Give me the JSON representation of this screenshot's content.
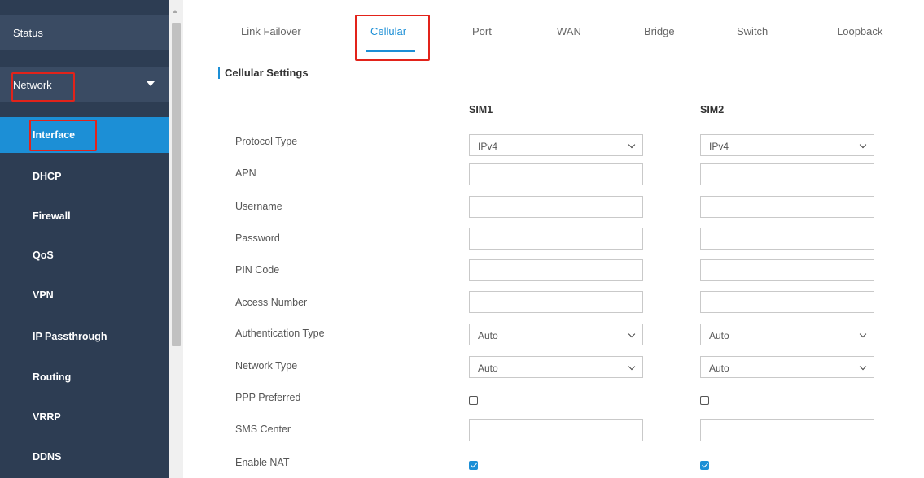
{
  "sidebar": {
    "items": [
      {
        "label": "Status"
      },
      {
        "label": "Network"
      },
      {
        "label": "Interface"
      },
      {
        "label": "DHCP"
      },
      {
        "label": "Firewall"
      },
      {
        "label": "QoS"
      },
      {
        "label": "VPN"
      },
      {
        "label": "IP Passthrough"
      },
      {
        "label": "Routing"
      },
      {
        "label": "VRRP"
      },
      {
        "label": "DDNS"
      }
    ]
  },
  "tabs": [
    {
      "label": "Link Failover"
    },
    {
      "label": "Cellular"
    },
    {
      "label": "Port"
    },
    {
      "label": "WAN"
    },
    {
      "label": "Bridge"
    },
    {
      "label": "Switch"
    },
    {
      "label": "Loopback"
    }
  ],
  "section": {
    "title": "Cellular Settings"
  },
  "columns": {
    "sim1": "SIM1",
    "sim2": "SIM2"
  },
  "rows": [
    {
      "label": "Protocol Type",
      "sim1": "IPv4",
      "sim2": "IPv4"
    },
    {
      "label": "APN",
      "sim1": "",
      "sim2": ""
    },
    {
      "label": "Username",
      "sim1": "",
      "sim2": ""
    },
    {
      "label": "Password",
      "sim1": "",
      "sim2": ""
    },
    {
      "label": "PIN Code",
      "sim1": "",
      "sim2": ""
    },
    {
      "label": "Access Number",
      "sim1": "",
      "sim2": ""
    },
    {
      "label": "Authentication Type",
      "sim1": "Auto",
      "sim2": "Auto"
    },
    {
      "label": "Network Type",
      "sim1": "Auto",
      "sim2": "Auto"
    },
    {
      "label": "PPP Preferred",
      "sim1": false,
      "sim2": false
    },
    {
      "label": "SMS Center",
      "sim1": "",
      "sim2": ""
    },
    {
      "label": "Enable NAT",
      "sim1": true,
      "sim2": true
    }
  ],
  "colors": {
    "sidebar": "#2d3d53",
    "accent": "#1c8fd6",
    "highlight": "#e2231a"
  }
}
